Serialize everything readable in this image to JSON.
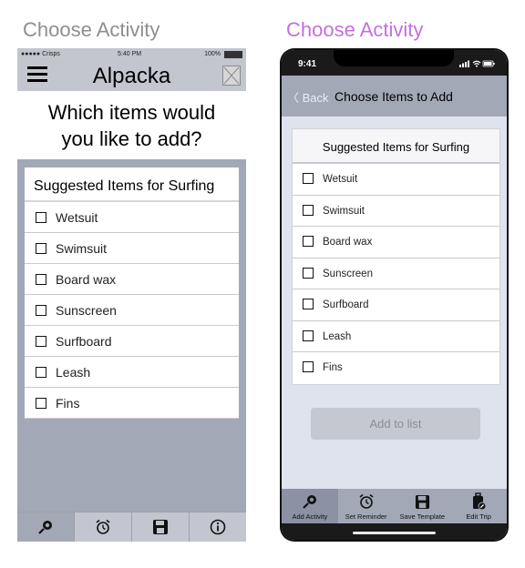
{
  "headings": {
    "left": "Choose Activity",
    "right": "Choose Activity"
  },
  "left_phone": {
    "status": {
      "carrier": "●●●●● Crisps",
      "time": "5:40 PM",
      "battery": "100%"
    },
    "title": "Alpacka",
    "question_line1": "Which items would",
    "question_line2": "you like to add?",
    "card_title": "Suggested Items for Surfing",
    "items": [
      {
        "label": "Wetsuit"
      },
      {
        "label": "Swimsuit"
      },
      {
        "label": "Board wax"
      },
      {
        "label": "Sunscreen"
      },
      {
        "label": "Surfboard"
      },
      {
        "label": "Leash"
      },
      {
        "label": "Fins"
      }
    ]
  },
  "right_phone": {
    "status": {
      "time": "9:41"
    },
    "back_label": "Back",
    "nav_title": "Choose Items to Add",
    "card_title": "Suggested Items for Surfing",
    "items": [
      {
        "label": "Wetsuit"
      },
      {
        "label": "Swimsuit"
      },
      {
        "label": "Board wax"
      },
      {
        "label": "Sunscreen"
      },
      {
        "label": "Surfboard"
      },
      {
        "label": "Leash"
      },
      {
        "label": "Fins"
      }
    ],
    "add_button": "Add to list",
    "tabs": [
      {
        "label": "Add Activity",
        "icon": "add-activity-icon"
      },
      {
        "label": "Set Reminder",
        "icon": "alarm-clock-icon"
      },
      {
        "label": "Save Template",
        "icon": "floppy-disk-icon"
      },
      {
        "label": "Edit Trip",
        "icon": "luggage-edit-icon"
      }
    ]
  },
  "colors": {
    "left_heading": "#8e8e93",
    "right_heading": "#c46fe0",
    "left_background": "#a3a8b7",
    "right_background": "#dfe3ee",
    "bar_gray": "#c3c6cf"
  }
}
